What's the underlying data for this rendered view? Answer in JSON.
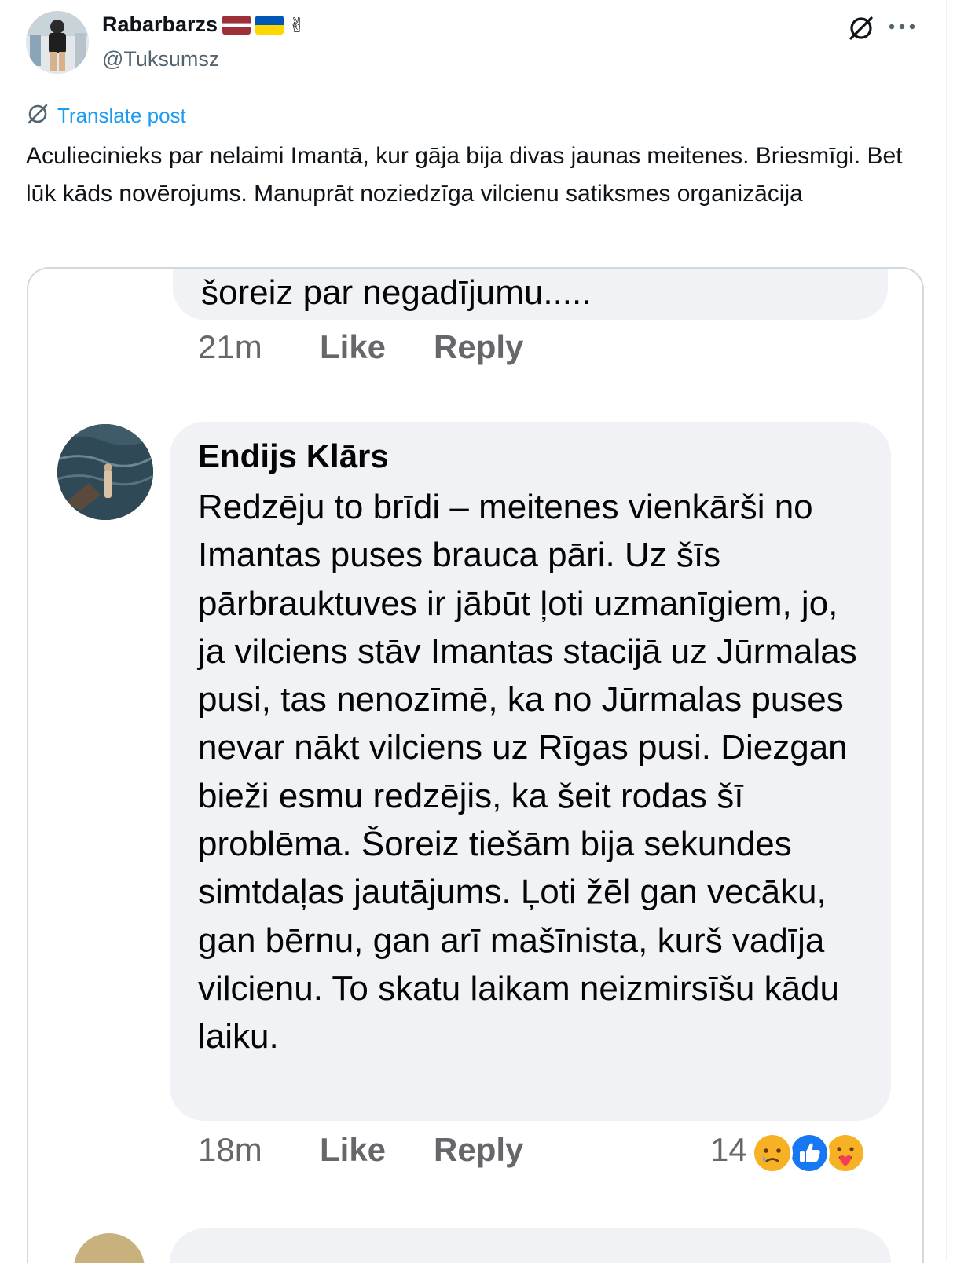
{
  "post": {
    "display_name": "Rabarbarzs",
    "handle": "@Tuksumsz",
    "victory_emoji": "✌",
    "translate_label": "Translate post",
    "text": "Aculiecinieks par nelaimi Imantā, kur gāja bija divas jaunas meitenes. Briesmīgi. Bet lūk kāds novērojums. Manuprāt noziedzīga vilcienu satiksmes organizācija",
    "icons": {
      "grok": "grok-icon",
      "more": "more-icon",
      "translate": "translate-icon"
    }
  },
  "screenshot": {
    "prev_comment_tail": "šoreiz par negadījumu.....",
    "prev_actions": {
      "time": "21m",
      "like": "Like",
      "reply": "Reply"
    },
    "comment": {
      "author": "Endijs Klārs",
      "text": "Redzēju to brīdi – meitenes vienkārši no Imantas puses brauca pāri. Uz šīs pārbrauktuves ir jābūt ļoti uzmanīgiem, jo, ja vilciens stāv Imantas stacijā uz Jūrmalas pusi, tas nenozīmē, ka no Jūrmalas puses nevar nākt vilciens uz Rīgas pusi. Diezgan bieži esmu redzējis, ka šeit rodas šī problēma. Šoreiz tiešām bija sekundes simtdaļas jautājums. Ļoti žēl gan vecāku, gan bērnu, gan arī mašīnista, kurš vadīja vilcienu. To skatu laikam neizmirsīšu kādu laiku.",
      "actions": {
        "time": "18m",
        "like": "Like",
        "reply": "Reply"
      },
      "reaction_count": "14",
      "reactions": [
        "sad-react-icon",
        "like-react-icon",
        "care-react-icon"
      ]
    }
  },
  "colors": {
    "link": "#1d9bf0",
    "fb_bubble": "#f0f2f5",
    "fb_meta": "#65676b",
    "fb_like": "#1877f2"
  }
}
